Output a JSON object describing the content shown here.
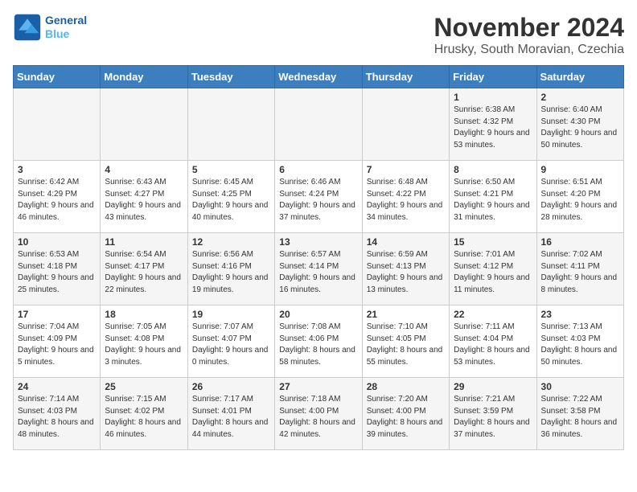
{
  "header": {
    "logo_line1": "General",
    "logo_line2": "Blue",
    "title": "November 2024",
    "subtitle": "Hrusky, South Moravian, Czechia"
  },
  "weekdays": [
    "Sunday",
    "Monday",
    "Tuesday",
    "Wednesday",
    "Thursday",
    "Friday",
    "Saturday"
  ],
  "weeks": [
    [
      {
        "day": "",
        "info": ""
      },
      {
        "day": "",
        "info": ""
      },
      {
        "day": "",
        "info": ""
      },
      {
        "day": "",
        "info": ""
      },
      {
        "day": "",
        "info": ""
      },
      {
        "day": "1",
        "info": "Sunrise: 6:38 AM\nSunset: 4:32 PM\nDaylight: 9 hours and 53 minutes."
      },
      {
        "day": "2",
        "info": "Sunrise: 6:40 AM\nSunset: 4:30 PM\nDaylight: 9 hours and 50 minutes."
      }
    ],
    [
      {
        "day": "3",
        "info": "Sunrise: 6:42 AM\nSunset: 4:29 PM\nDaylight: 9 hours and 46 minutes."
      },
      {
        "day": "4",
        "info": "Sunrise: 6:43 AM\nSunset: 4:27 PM\nDaylight: 9 hours and 43 minutes."
      },
      {
        "day": "5",
        "info": "Sunrise: 6:45 AM\nSunset: 4:25 PM\nDaylight: 9 hours and 40 minutes."
      },
      {
        "day": "6",
        "info": "Sunrise: 6:46 AM\nSunset: 4:24 PM\nDaylight: 9 hours and 37 minutes."
      },
      {
        "day": "7",
        "info": "Sunrise: 6:48 AM\nSunset: 4:22 PM\nDaylight: 9 hours and 34 minutes."
      },
      {
        "day": "8",
        "info": "Sunrise: 6:50 AM\nSunset: 4:21 PM\nDaylight: 9 hours and 31 minutes."
      },
      {
        "day": "9",
        "info": "Sunrise: 6:51 AM\nSunset: 4:20 PM\nDaylight: 9 hours and 28 minutes."
      }
    ],
    [
      {
        "day": "10",
        "info": "Sunrise: 6:53 AM\nSunset: 4:18 PM\nDaylight: 9 hours and 25 minutes."
      },
      {
        "day": "11",
        "info": "Sunrise: 6:54 AM\nSunset: 4:17 PM\nDaylight: 9 hours and 22 minutes."
      },
      {
        "day": "12",
        "info": "Sunrise: 6:56 AM\nSunset: 4:16 PM\nDaylight: 9 hours and 19 minutes."
      },
      {
        "day": "13",
        "info": "Sunrise: 6:57 AM\nSunset: 4:14 PM\nDaylight: 9 hours and 16 minutes."
      },
      {
        "day": "14",
        "info": "Sunrise: 6:59 AM\nSunset: 4:13 PM\nDaylight: 9 hours and 13 minutes."
      },
      {
        "day": "15",
        "info": "Sunrise: 7:01 AM\nSunset: 4:12 PM\nDaylight: 9 hours and 11 minutes."
      },
      {
        "day": "16",
        "info": "Sunrise: 7:02 AM\nSunset: 4:11 PM\nDaylight: 9 hours and 8 minutes."
      }
    ],
    [
      {
        "day": "17",
        "info": "Sunrise: 7:04 AM\nSunset: 4:09 PM\nDaylight: 9 hours and 5 minutes."
      },
      {
        "day": "18",
        "info": "Sunrise: 7:05 AM\nSunset: 4:08 PM\nDaylight: 9 hours and 3 minutes."
      },
      {
        "day": "19",
        "info": "Sunrise: 7:07 AM\nSunset: 4:07 PM\nDaylight: 9 hours and 0 minutes."
      },
      {
        "day": "20",
        "info": "Sunrise: 7:08 AM\nSunset: 4:06 PM\nDaylight: 8 hours and 58 minutes."
      },
      {
        "day": "21",
        "info": "Sunrise: 7:10 AM\nSunset: 4:05 PM\nDaylight: 8 hours and 55 minutes."
      },
      {
        "day": "22",
        "info": "Sunrise: 7:11 AM\nSunset: 4:04 PM\nDaylight: 8 hours and 53 minutes."
      },
      {
        "day": "23",
        "info": "Sunrise: 7:13 AM\nSunset: 4:03 PM\nDaylight: 8 hours and 50 minutes."
      }
    ],
    [
      {
        "day": "24",
        "info": "Sunrise: 7:14 AM\nSunset: 4:03 PM\nDaylight: 8 hours and 48 minutes."
      },
      {
        "day": "25",
        "info": "Sunrise: 7:15 AM\nSunset: 4:02 PM\nDaylight: 8 hours and 46 minutes."
      },
      {
        "day": "26",
        "info": "Sunrise: 7:17 AM\nSunset: 4:01 PM\nDaylight: 8 hours and 44 minutes."
      },
      {
        "day": "27",
        "info": "Sunrise: 7:18 AM\nSunset: 4:00 PM\nDaylight: 8 hours and 42 minutes."
      },
      {
        "day": "28",
        "info": "Sunrise: 7:20 AM\nSunset: 4:00 PM\nDaylight: 8 hours and 39 minutes."
      },
      {
        "day": "29",
        "info": "Sunrise: 7:21 AM\nSunset: 3:59 PM\nDaylight: 8 hours and 37 minutes."
      },
      {
        "day": "30",
        "info": "Sunrise: 7:22 AM\nSunset: 3:58 PM\nDaylight: 8 hours and 36 minutes."
      }
    ]
  ]
}
